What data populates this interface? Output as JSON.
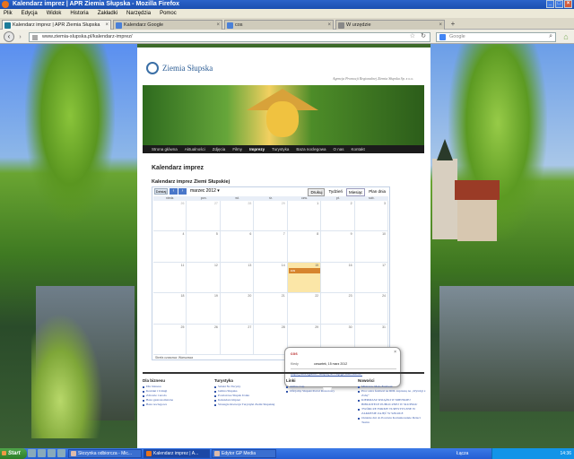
{
  "window": {
    "title": "Kalendarz imprez | APR Ziemia Słupska - Mozilla Firefox"
  },
  "menu": [
    "Plik",
    "Edycja",
    "Widok",
    "Historia",
    "Zakładki",
    "Narzędzia",
    "Pomoc"
  ],
  "tabs": [
    {
      "label": "Kalendarz imprez | APR Ziemia Słupska"
    },
    {
      "label": "Kalendarz Google"
    },
    {
      "label": "cos"
    },
    {
      "label": "W urzędzie"
    }
  ],
  "nav": {
    "url": "www.ziemia-slupska.pl/kalendarz-imprez/",
    "search_placeholder": "Google"
  },
  "site": {
    "logo_text": "Ziemia Słupska",
    "tagline": "Agencja Promocji Regionalnej Ziemia Słupska Sp. z o.o.",
    "menu": [
      "Strona główna",
      "Aktualności",
      "Zdjęcia",
      "Filmy",
      "Imprezy",
      "Turystyka",
      "Baza noclegowa",
      "O nas",
      "Kontakt"
    ],
    "page_title": "Kalendarz imprez"
  },
  "calendar": {
    "title": "Kalendarz imprez Ziemi Słupskiej",
    "today_label": "Dzisiaj",
    "month_label": "marzec 2012",
    "views": {
      "print": "Drukuj",
      "week": "Tydzień",
      "month": "Miesiąc",
      "agenda": "Plan dnia"
    },
    "weekdays": [
      "niedz.",
      "pon.",
      "wt.",
      "śr.",
      "czw.",
      "pt.",
      "sob."
    ],
    "weeks": [
      [
        "26",
        "27",
        "28",
        "29",
        "1",
        "2",
        "3"
      ],
      [
        "4",
        "5",
        "6",
        "7",
        "8",
        "9",
        "10"
      ],
      [
        "11",
        "12",
        "13",
        "14",
        "15",
        "16",
        "17"
      ],
      [
        "18",
        "19",
        "20",
        "21",
        "22",
        "23",
        "24"
      ],
      [
        "25",
        "26",
        "27",
        "28",
        "29",
        "30",
        "31"
      ]
    ],
    "event_label": "cos",
    "footer_tz": "Strefa czasowa: Warszawa",
    "google_button": "+ Google Calendar",
    "popup": {
      "title": "cos",
      "when_label": "Kiedy",
      "when_value": "czwartek, 15 marz 2012",
      "links": "więcej szczegółów» skopiuj do mojego kalendarza»"
    }
  },
  "footer": {
    "columns": [
      {
        "heading": "Dla biznesu",
        "items": [
          "Dla biznesu",
          "Kontakt i Usługi",
          "Zdrowie i uroda",
          "Baza gastronomiczna",
          "Baza noclegowa"
        ]
      },
      {
        "heading": "Turystyka",
        "items": [
          "Szlaki Na Turysty",
          "Gmina Słupska",
          "Powiatowe Słupsk Ustka",
          "Kalendarz imprez",
          "Strategia Rozwoju Turystyki Ziemi Słupskiej"
        ]
      },
      {
        "heading": "Linki",
        "items": [
          "Ambre Cup",
          "Oficjalny Słupski Portal Rowerowy"
        ]
      },
      {
        "heading": "Nowości",
        "items": [
          "Mistrzów Mało Festiwal",
          "Proc ostra festiwal na RDL zapraszą na „Wyścigi z Zabą”",
          "KIERMASZ KSIĄŻKI W MIEJSKIEJ BIBLIOTECE PUBLICZNEJ W SŁUPSKU",
          "TWÓRCZE FORMY TURYSTYCZNE W ZAKRESIE ZAJĘĆ W SZKOLE",
          "Ostatnie dni do Powiatu Kartuzkowskie Dzieci Teatru"
        ]
      }
    ]
  },
  "taskbar": {
    "start": "Start",
    "tasks": [
      "Skrzynka odbiorcza - Mic...",
      "Kalendarz imprez | A...",
      "Edytor GP Media"
    ],
    "tray_text": "Łącza",
    "clock": "14:36"
  }
}
